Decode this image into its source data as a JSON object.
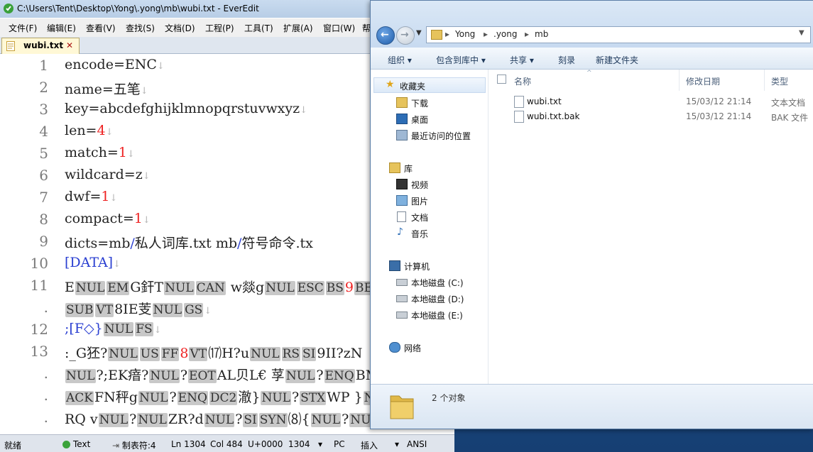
{
  "editor": {
    "title": "C:\\Users\\Tent\\Desktop\\Yong\\.yong\\mb\\wubi.txt - EverEdit",
    "menu": [
      "文件(F)",
      "编辑(E)",
      "查看(V)",
      "查找(S)",
      "文档(D)",
      "工程(P)",
      "工具(T)",
      "扩展(A)",
      "窗口(W)",
      "帮"
    ],
    "tab_label": "wubi.txt",
    "tab_close": "✕",
    "line_numbers": [
      "1",
      "2",
      "3",
      "4",
      "5",
      "6",
      "7",
      "8",
      "9",
      "10",
      "11",
      ".",
      "12",
      "13",
      ".",
      ".",
      "."
    ],
    "lines": {
      "l1": "encode=ENC",
      "l2": "name=五笔",
      "l3": "key=abcdefghijklmnopqrstuvwxyz",
      "l4a": "len=",
      "l4b": "4",
      "l5a": "match=",
      "l5b": "1",
      "l6": "wildcard=z",
      "l7a": "dwf=",
      "l7b": "1",
      "l8a": "compact=",
      "l8b": "1",
      "l9a": "dicts=mb",
      "l9b": "/",
      "l9c": "私人词库.txt mb",
      "l9d": "/",
      "l9e": "符号命令.tx",
      "l10": "[DATA]",
      "l11": [
        "E",
        "NUL",
        "EM",
        "G釬T",
        "NUL",
        "CAN",
        "  w燚g",
        "NUL",
        "ESC",
        "BS",
        "9",
        "BE"
      ],
      "l11c": [
        "SUB",
        "VT",
        "8IE芰",
        "NUL",
        "GS"
      ],
      "l12": [
        ";[F◇}",
        "NUL",
        "FS"
      ],
      "l13": [
        ":_G狉?",
        "NUL",
        "US",
        "FF",
        "8",
        "VT",
        "⒄H?u",
        "NUL",
        "RS",
        "SI",
        "9II?zN"
      ],
      "l13c1": [
        "NUL",
        "?;EK瘖?",
        "NUL",
        "?",
        "EOT",
        "AL贝L€ 莩",
        "NUL",
        "?",
        "ENQ",
        "BM"
      ],
      "l13c2": [
        "ACK",
        "FN秤g",
        "NUL",
        "?",
        "ENQ",
        "DC2",
        "澈}",
        "NUL",
        "?",
        "STX",
        "WP  }",
        "N"
      ],
      "l13c3": [
        "RQ  v",
        "NUL",
        "?",
        "NUL",
        "ZR?d",
        "NUL",
        "?",
        "SI",
        "SYN",
        "⑻{",
        "NUL",
        "?",
        "NUL"
      ]
    },
    "lf_glyph": "↓",
    "status": {
      "ready": "就绪",
      "type": "Text",
      "tab": "制表符:4",
      "ln": "Ln 1304",
      "col": "Col 484",
      "code": "U+0000",
      "num": "1304",
      "eol": "PC",
      "mode": "插入",
      "enc": "ANSI"
    }
  },
  "explorer": {
    "address": [
      "Yong",
      ".yong",
      "mb"
    ],
    "toolbar": [
      "组织 ▾",
      "包含到库中 ▾",
      "共享 ▾",
      "刻录",
      "新建文件夹"
    ],
    "nav": {
      "favorites": "收藏夹",
      "downloads": "下载",
      "desktop": "桌面",
      "recent": "最近访问的位置",
      "libraries": "库",
      "videos": "视频",
      "pictures": "图片",
      "documents": "文档",
      "music": "音乐",
      "computer": "计算机",
      "drive_c": "本地磁盘 (C:)",
      "drive_d": "本地磁盘 (D:)",
      "drive_e": "本地磁盘 (E:)",
      "network": "网络"
    },
    "columns": {
      "name": "名称",
      "date": "修改日期",
      "type": "类型"
    },
    "files": [
      {
        "name": "wubi.txt",
        "date": "15/03/12 21:14",
        "type": "文本文档"
      },
      {
        "name": "wubi.txt.bak",
        "date": "15/03/12 21:14",
        "type": "BAK 文件"
      }
    ],
    "item_count": "2 个对象"
  },
  "colors": {
    "accent": "#1e395b",
    "number": "#e22222",
    "control_bg": "#c8c8c8"
  }
}
